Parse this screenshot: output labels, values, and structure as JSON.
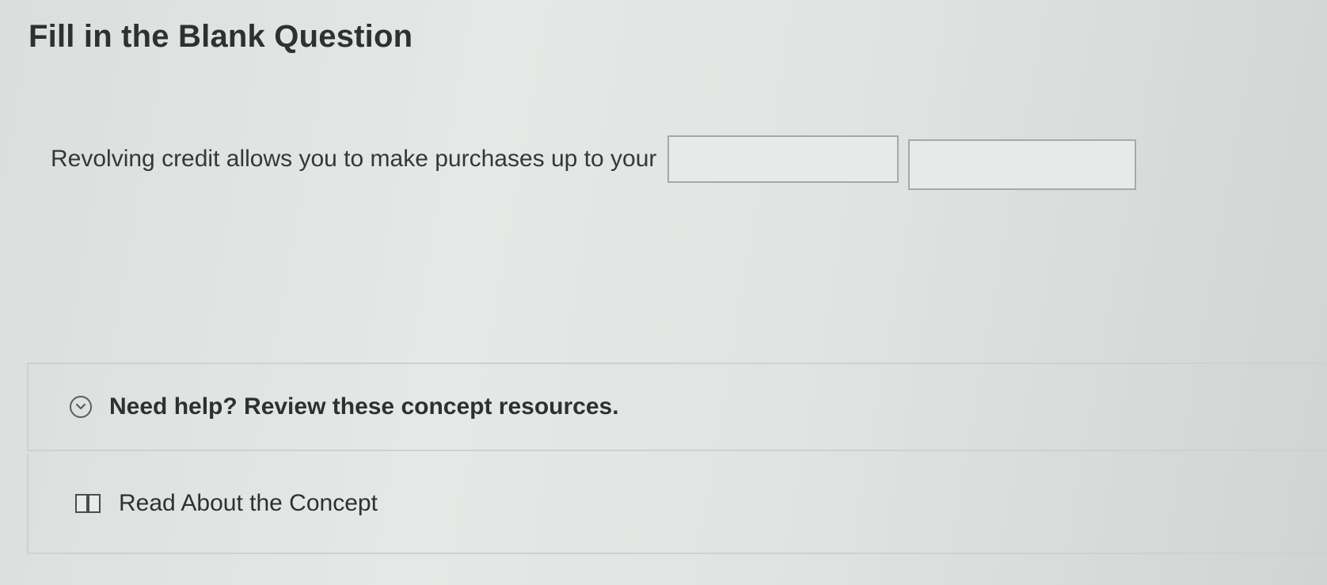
{
  "question": {
    "title": "Fill in the Blank Question",
    "prompt": "Revolving credit allows you to make purchases up to your",
    "blank_1_value": "",
    "blank_2_value": ""
  },
  "help": {
    "toggle_label": "Need help? Review these concept resources.",
    "icon": "chevron-down-circle-icon"
  },
  "resources": [
    {
      "label": "Read About the Concept",
      "icon": "book-icon"
    }
  ]
}
